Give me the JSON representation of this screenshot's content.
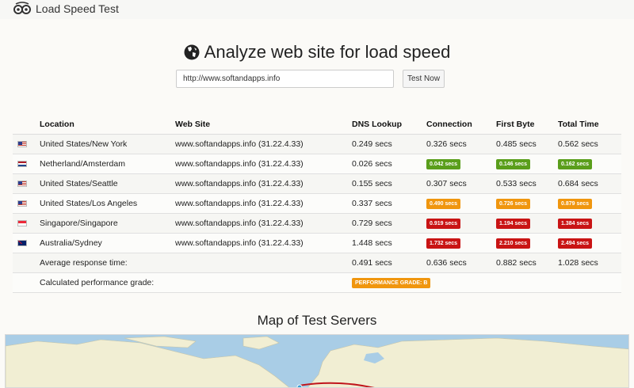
{
  "app": {
    "title": "Load Speed Test",
    "logo_icon": "glasses-icon"
  },
  "heading": {
    "text": "Analyze web site for load speed",
    "icon": "globe-icon"
  },
  "form": {
    "url_value": "http://www.softandapps.info",
    "button_label": "Test Now"
  },
  "table": {
    "headers": {
      "location": "Location",
      "website": "Web Site",
      "dns": "DNS Lookup",
      "connection": "Connection",
      "first_byte": "First Byte",
      "total": "Total Time"
    },
    "rows": [
      {
        "flag": "us-flag-icon",
        "location": "United States/New York",
        "website": "www.softandapps.info (31.22.4.33)",
        "dns": "0.249 secs",
        "connection": "0.326 secs",
        "first_byte": "0.485 secs",
        "total": "0.562 secs"
      },
      {
        "flag": "nl-flag-icon",
        "location": "Netherland/Amsterdam",
        "website": "www.softandapps.info (31.22.4.33)",
        "dns": "0.026 secs",
        "connection": "0.042 secs",
        "first_byte": "0.146 secs",
        "total": "0.162 secs"
      },
      {
        "flag": "us-flag-icon",
        "location": "United States/Seattle",
        "website": "www.softandapps.info (31.22.4.33)",
        "dns": "0.155 secs",
        "connection": "0.307 secs",
        "first_byte": "0.533 secs",
        "total": "0.684 secs"
      },
      {
        "flag": "us-flag-icon",
        "location": "United States/Los Angeles",
        "website": "www.softandapps.info (31.22.4.33)",
        "dns": "0.337 secs",
        "connection": "0.490 secs",
        "first_byte": "0.726 secs",
        "total": "0.879 secs"
      },
      {
        "flag": "sg-flag-icon",
        "location": "Singapore/Singapore",
        "website": "www.softandapps.info (31.22.4.33)",
        "dns": "0.729 secs",
        "connection": "0.919 secs",
        "first_byte": "1.194 secs",
        "total": "1.384 secs"
      },
      {
        "flag": "au-flag-icon",
        "location": "Australia/Sydney",
        "website": "www.softandapps.info (31.22.4.33)",
        "dns": "1.448 secs",
        "connection": "1.732 secs",
        "first_byte": "2.210 secs",
        "total": "2.494 secs"
      }
    ],
    "average": {
      "label": "Average response time:",
      "dns": "0.491 secs",
      "connection": "0.636 secs",
      "first_byte": "0.882 secs",
      "total": "1.028 secs"
    },
    "grade": {
      "label": "Calculated performance grade:",
      "badge": "PERFORMANCE GRADE: B"
    }
  },
  "badge_colors": {
    "green": "#5a9e1b",
    "orange": "#f0960e",
    "red": "#c91414"
  },
  "map": {
    "title": "Map of Test Servers"
  }
}
